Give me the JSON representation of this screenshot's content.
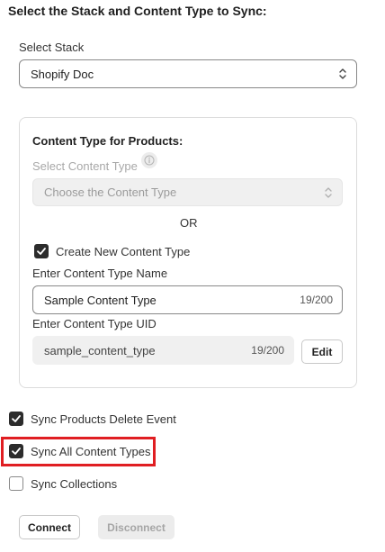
{
  "heading": "Select the Stack and Content Type to Sync:",
  "stack": {
    "label": "Select Stack",
    "value": "Shopify Doc"
  },
  "card": {
    "title": "Content Type for Products:",
    "select_content_type_label": "Select Content Type",
    "select_placeholder": "Choose the Content Type",
    "or_text": "OR",
    "create_new_label": "Create New Content Type",
    "create_new_checked": true,
    "name_label": "Enter Content Type Name",
    "name_value": "Sample Content Type",
    "name_counter": "19/200",
    "uid_label": "Enter Content Type UID",
    "uid_value": "sample_content_type",
    "uid_counter": "19/200",
    "edit_button": "Edit"
  },
  "options": [
    {
      "label": "Sync Products Delete Event",
      "checked": true
    },
    {
      "label": "Sync All Content Types",
      "checked": true,
      "highlighted": true
    },
    {
      "label": "Sync Collections",
      "checked": false
    }
  ],
  "actions": {
    "connect": "Connect",
    "disconnect": "Disconnect"
  },
  "colors": {
    "highlight": "#e01e22",
    "checkbox_fill": "#2c2c2c"
  },
  "icons": {
    "select_arrows": "chevron-up-down-icon",
    "info": "info-icon",
    "check": "check-icon"
  }
}
